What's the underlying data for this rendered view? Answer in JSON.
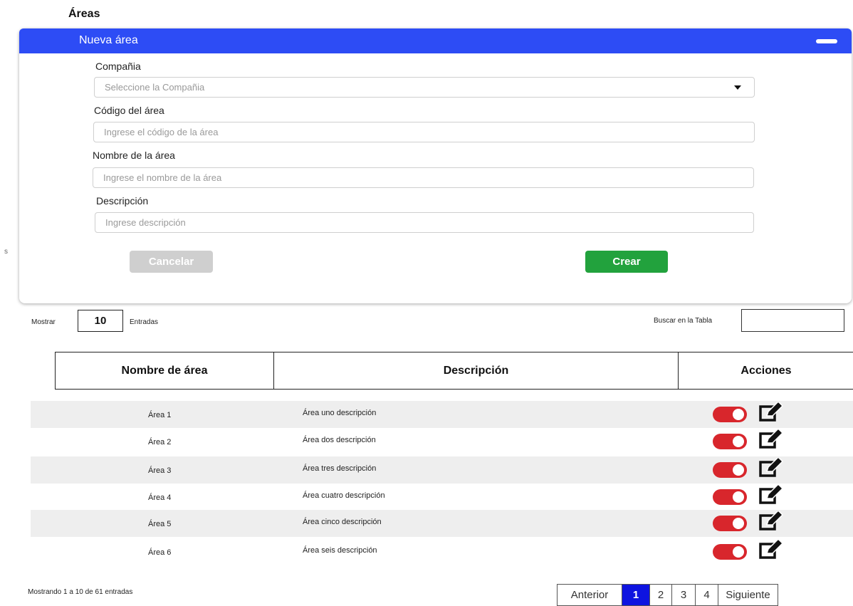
{
  "page": {
    "title": "Áreas",
    "stray_text": "s"
  },
  "form": {
    "header_title": "Nueva área",
    "company": {
      "label": "Compañia",
      "placeholder": "Seleccione la Compañia"
    },
    "code": {
      "label": "Código del área",
      "placeholder": "Ingrese el código de la área"
    },
    "name": {
      "label": "Nombre de la área",
      "placeholder": "Ingrese el nombre de la área"
    },
    "description": {
      "label": "Descripción",
      "placeholder": "Ingrese descripción"
    },
    "cancel_label": "Cancelar",
    "create_label": "Crear"
  },
  "table_controls": {
    "show_label": "Mostrar",
    "page_length": "10",
    "entries_label": "Entradas",
    "search_label": "Buscar en la Tabla"
  },
  "table": {
    "headers": [
      "Nombre de área",
      "Descripción",
      "Acciones"
    ],
    "rows": [
      {
        "name": "Área 1",
        "description": "Área uno descripción",
        "active": true
      },
      {
        "name": "Área 2",
        "description": "Área dos descripción",
        "active": true
      },
      {
        "name": "Área 3",
        "description": "Área tres descripción",
        "active": true
      },
      {
        "name": "Área 4",
        "description": "Área cuatro descripción",
        "active": true
      },
      {
        "name": "Área 5",
        "description": "Área cinco descripción",
        "active": true
      },
      {
        "name": "Área 6",
        "description": "Área seis descripción",
        "active": true
      }
    ]
  },
  "footer": {
    "info": "Mostrando 1 a 10 de 61 entradas",
    "prev_label": "Anterior",
    "pages": [
      "1",
      "2",
      "3",
      "4"
    ],
    "current_page": "1",
    "next_label": "Siguiente"
  },
  "colors": {
    "header_blue": "#2d4cf5",
    "create_green": "#22a23d",
    "cancel_gray": "#cfcfcf",
    "toggle_red": "#d8262c",
    "pager_active": "#0e14e0"
  },
  "icons": {
    "collapse": "minus-icon",
    "dropdown": "caret-down-icon",
    "edit": "edit-icon"
  }
}
